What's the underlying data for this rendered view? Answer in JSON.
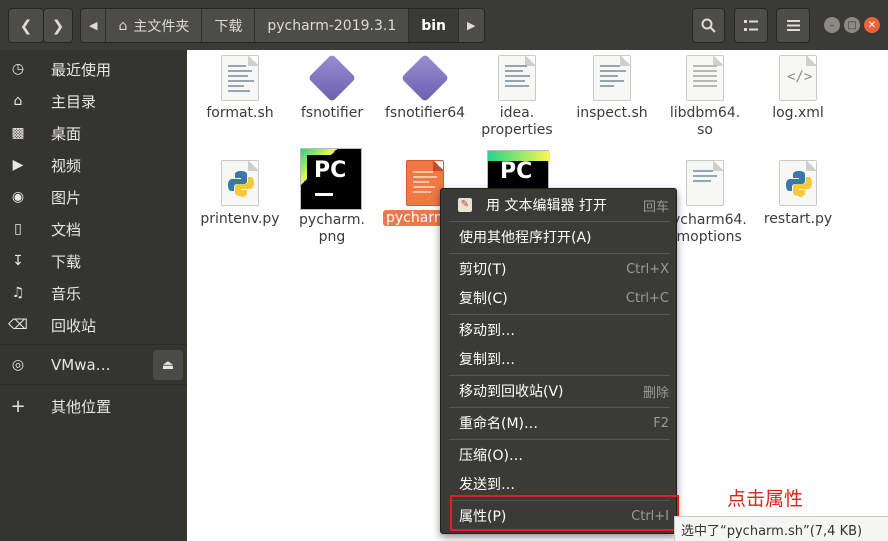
{
  "header": {
    "back_icon": "chevron-left",
    "forward_icon": "chevron-right",
    "breadcrumbs": [
      "主文件夹",
      "下载",
      "pycharm-2019.3.1",
      "bin"
    ],
    "search_icon": "search",
    "view_icon": "list-view",
    "menu_icon": "hamburger"
  },
  "sidebar": {
    "items": [
      {
        "label": "最近使用",
        "icon": "clock-icon"
      },
      {
        "label": "主目录",
        "icon": "home-icon"
      },
      {
        "label": "桌面",
        "icon": "desktop-icon"
      },
      {
        "label": "视频",
        "icon": "video-icon"
      },
      {
        "label": "图片",
        "icon": "camera-icon"
      },
      {
        "label": "文档",
        "icon": "document-icon"
      },
      {
        "label": "下载",
        "icon": "download-icon"
      },
      {
        "label": "音乐",
        "icon": "music-icon"
      },
      {
        "label": "回收站",
        "icon": "trash-icon"
      }
    ],
    "device": {
      "label": "VMwa…",
      "icon": "disc-icon"
    },
    "other": {
      "label": "其他位置",
      "icon": "plus-icon"
    }
  },
  "files": [
    {
      "name": "format.sh",
      "type": "text"
    },
    {
      "name": "fsnotifier",
      "type": "exec"
    },
    {
      "name": "fsnotifier64",
      "type": "exec"
    },
    {
      "name": "idea.\nproperties",
      "type": "text"
    },
    {
      "name": "inspect.sh",
      "type": "text"
    },
    {
      "name": "libdbm64.\nso",
      "type": "text"
    },
    {
      "name": "log.xml",
      "type": "xml"
    },
    {
      "name": "printenv.py",
      "type": "python"
    },
    {
      "name": "pycharm.\npng",
      "type": "pycharm"
    },
    {
      "name": "pycharm.sh",
      "type": "shell",
      "selected": true
    },
    {
      "name": "pycharm64.\nvmoptions",
      "type": "text"
    },
    {
      "name": "restart.py",
      "type": "python"
    }
  ],
  "selected_label_visible": "pycharm",
  "context_menu": {
    "items": [
      {
        "label": "用 文本编辑器 打开",
        "shortcut": "回车",
        "icon": "edit-icon"
      },
      {
        "label": "使用其他程序打开(A)",
        "shortcut": ""
      },
      {
        "label": "剪切(T)",
        "shortcut": "Ctrl+X"
      },
      {
        "label": "复制(C)",
        "shortcut": "Ctrl+C"
      },
      {
        "label": "移动到…",
        "shortcut": ""
      },
      {
        "label": "复制到…",
        "shortcut": ""
      },
      {
        "label": "移动到回收站(V)",
        "shortcut": "删除"
      },
      {
        "label": "重命名(M)…",
        "shortcut": "F2"
      },
      {
        "label": "压缩(O)…",
        "shortcut": ""
      },
      {
        "label": "发送到…",
        "shortcut": ""
      },
      {
        "label": "属性(P)",
        "shortcut": "Ctrl+I"
      }
    ]
  },
  "annotation": "点击属性",
  "status_bar": "选中了“pycharm.sh”(7,4 KB)",
  "colors": {
    "accent": "#f07746",
    "annotation": "#e0201c",
    "header": "#3a3a37",
    "sidebar": "#343431"
  }
}
